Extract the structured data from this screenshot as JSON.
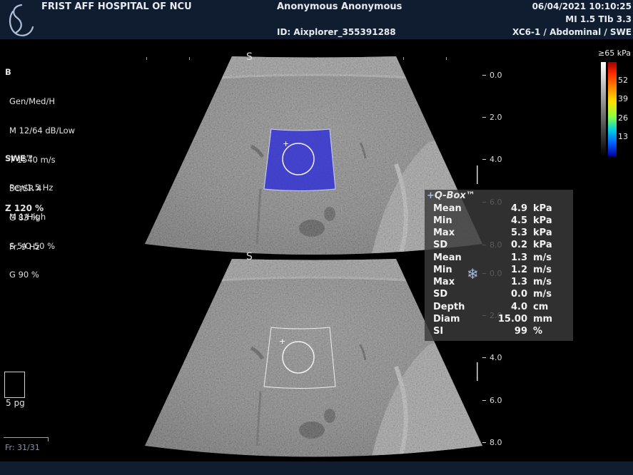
{
  "header": {
    "hospital": "FRIST AFF HOSPITAL OF NCU",
    "patient_name": "Anonymous Anonymous",
    "patient_id": "ID: Aixplorer_355391288",
    "datetime": "06/04/2021 10:10:25",
    "indices": "MI 1.5  TIb  3.3",
    "probe_preset": "XC6-1 / Abdominal / SWE"
  },
  "bmode": {
    "title": "B",
    "lines": [
      "Gen/Med/H",
      "M 12/64 dB/Low",
      "T 1540 m/s",
      "SC/SR 4",
      "G 83 %",
      "Fr. 9 Hz"
    ]
  },
  "swe": {
    "title": "SWE™",
    "lines": [
      "Pen/1.5 Hz",
      "M 1/High",
      "S 5/O 50 %",
      "G 90 %"
    ]
  },
  "zoom": "Z  120  %",
  "depth_labels": [
    "0.0",
    "2.0",
    "4.0",
    "6.0",
    "8.0"
  ],
  "colorbar": {
    "max_label": "≥65 kPa",
    "values": [
      "52",
      "39",
      "26",
      "13"
    ]
  },
  "qbox": {
    "title": "Q-Box™",
    "plus": "+",
    "rows": [
      {
        "label": "Mean",
        "value": "4.9",
        "unit": "kPa"
      },
      {
        "label": "Min",
        "value": "4.5",
        "unit": "kPa"
      },
      {
        "label": "Max",
        "value": "5.3",
        "unit": "kPa"
      },
      {
        "label": "SD",
        "value": "0.2",
        "unit": "kPa"
      },
      {
        "label": "Mean",
        "value": "1.3",
        "unit": "m/s"
      },
      {
        "label": "Min",
        "value": "1.2",
        "unit": "m/s"
      },
      {
        "label": "Max",
        "value": "1.3",
        "unit": "m/s"
      },
      {
        "label": "SD",
        "value": "0.0",
        "unit": "m/s"
      },
      {
        "label": "Depth",
        "value": "4.0",
        "unit": "cm"
      },
      {
        "label": "Diam",
        "value": "15.00",
        "unit": "mm"
      },
      {
        "label": "SI",
        "value": "99",
        "unit": "%"
      }
    ]
  },
  "freeze_icon": "snowflake-icon",
  "freeze_glyph": "❄",
  "pages": "5 pg",
  "frame": "Fr: 31/31",
  "colors": {
    "header_bg": "#101d31",
    "swe_roi": "#2a2ad8",
    "qbox_bg": "#3a3a3a"
  }
}
